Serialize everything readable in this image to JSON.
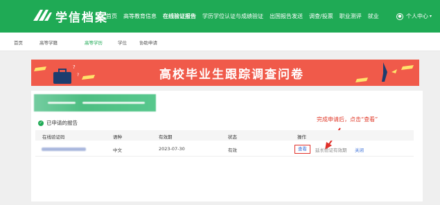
{
  "header": {
    "brand": "学信档案",
    "nav": [
      "首页",
      "高等教育信息",
      "在线验证报告",
      "学历学位认证与成绩验证",
      "出国报告发送",
      "调查/投票",
      "职业测评",
      "就业"
    ],
    "active_nav": "在线验证报告",
    "account": "个人中心"
  },
  "subnav": [
    "首页",
    "高等学籍",
    "高等学历",
    "学位",
    "协助申请"
  ],
  "subnav_active": "高等学历",
  "banner": {
    "title": "高校毕业生跟踪调查问卷"
  },
  "section": {
    "title": "已申请的报告"
  },
  "annotation": "完成申请后，点击“查看”",
  "table": {
    "headers": [
      "在线验证码",
      "语种",
      "有效期",
      "状态",
      "操作"
    ],
    "rows": [
      {
        "language": "中文",
        "expiry": "2023-07-30",
        "status": "有效",
        "view": "查看",
        "extend": "延长验证有效期",
        "close": "关闭"
      }
    ]
  },
  "colors": {
    "brand": "#1faa55",
    "banner": "#f05a4a",
    "annotation": "#e03a2a",
    "link": "#3a6fd8"
  }
}
